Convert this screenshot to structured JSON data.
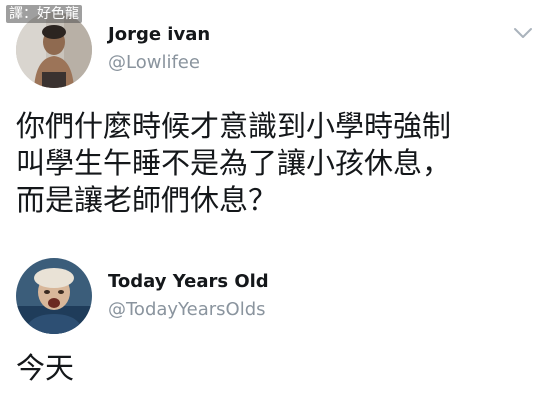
{
  "watermark": {
    "text": "譯：好色龍"
  },
  "tweets": [
    {
      "avatar": "profile-photo",
      "display_name": "Jorge ivan",
      "handle": "@Lowlifee",
      "text_lines": [
        "你們什麼時候才意識到小學時強制",
        "叫學生午睡不是為了讓小孩休息，",
        "而是讓老師們休息？"
      ]
    },
    {
      "avatar": "profile-photo",
      "display_name": "Today Years Old",
      "handle": "@TodayYearsOlds",
      "text_lines": [
        "今天"
      ]
    }
  ],
  "icons": {
    "menu": "chevron-down-icon"
  },
  "colors": {
    "text": "#14171a",
    "secondary": "#8a949e"
  }
}
